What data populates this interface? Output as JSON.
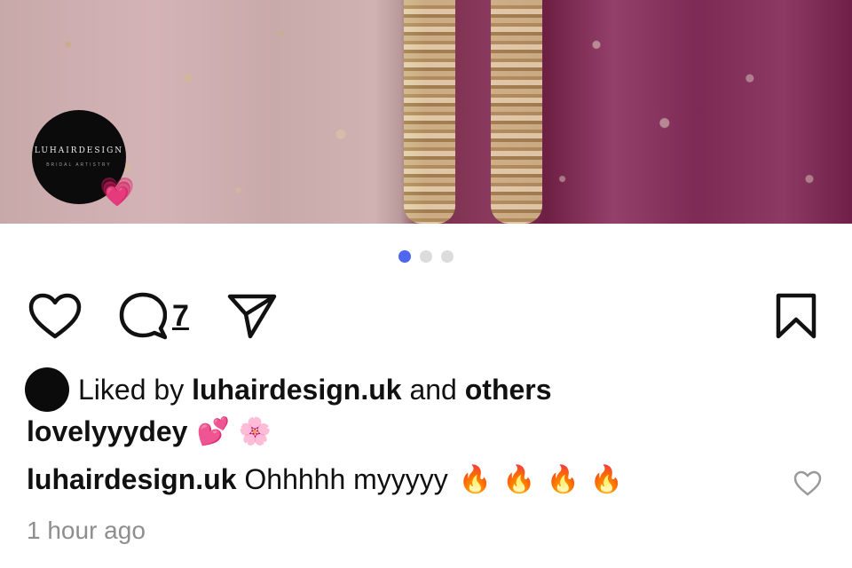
{
  "post": {
    "profile_badge": {
      "brand": "LUHAIRDESIGN",
      "subtitle": "BRIDAL ARTISTRY",
      "sticker": "💗"
    },
    "carousel": {
      "count": 3,
      "active_index": 0,
      "active_color": "#4f67ef",
      "inactive_color": "#dcdcdc"
    },
    "actions": {
      "like_icon": "heart-outline-icon",
      "comment_icon": "comment-bubble-icon",
      "comment_count": "7",
      "share_icon": "paper-plane-icon",
      "save_icon": "bookmark-icon"
    },
    "likes": {
      "prefix": "Liked by",
      "user": "luhairdesign.uk",
      "joiner": "and",
      "suffix": "others"
    },
    "caption": {
      "username": "lovelyyydey",
      "emojis": [
        "💕",
        "🌸"
      ]
    },
    "comment": {
      "username": "luhairdesign.uk",
      "text": "Ohhhhh myyyyy",
      "emojis": [
        "🔥",
        "🔥",
        "🔥",
        "🔥"
      ],
      "like_icon": "small-heart-outline-icon"
    },
    "timestamp": "1 hour ago"
  }
}
